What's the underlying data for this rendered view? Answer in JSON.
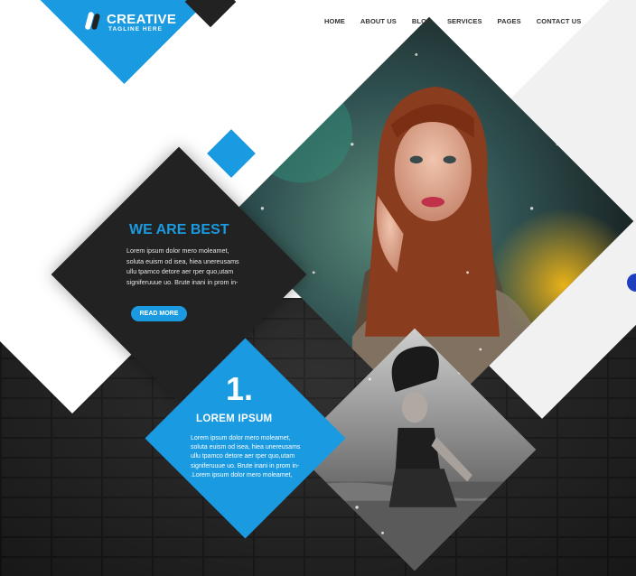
{
  "logo": {
    "title": "CREATIVE",
    "tagline": "TAGLINE HERE"
  },
  "nav": [
    "HOME",
    "ABOUT US",
    "BLOG",
    "SERVICES",
    "PAGES",
    "CONTACT US"
  ],
  "feature": {
    "title": "WE ARE BEST",
    "lines": [
      "Lorem ipsum dolor  mero moleamet,",
      "soluta euism od isea, hiea unereusams",
      "ullu tpamco detore  aer rper quo,utam",
      "signiferuuue uo. Brute inani in prom in-"
    ],
    "button": "READ MORE"
  },
  "step": {
    "number": "1.",
    "title": "LOREM IPSUM",
    "lines": [
      "Lorem ipsum dolor  mero moleamet,",
      "soluta euism od isea, hiea unereusams",
      "ullu tpamco detore  aer rper quo,utam",
      "signiferuuue uo. Brute inani in prom in-",
      ".Lorem ipsum dolor  mero moleamet,"
    ]
  },
  "colors": {
    "accent": "#1a9ae0",
    "dark": "#222222",
    "light": "#f1f1f1"
  }
}
